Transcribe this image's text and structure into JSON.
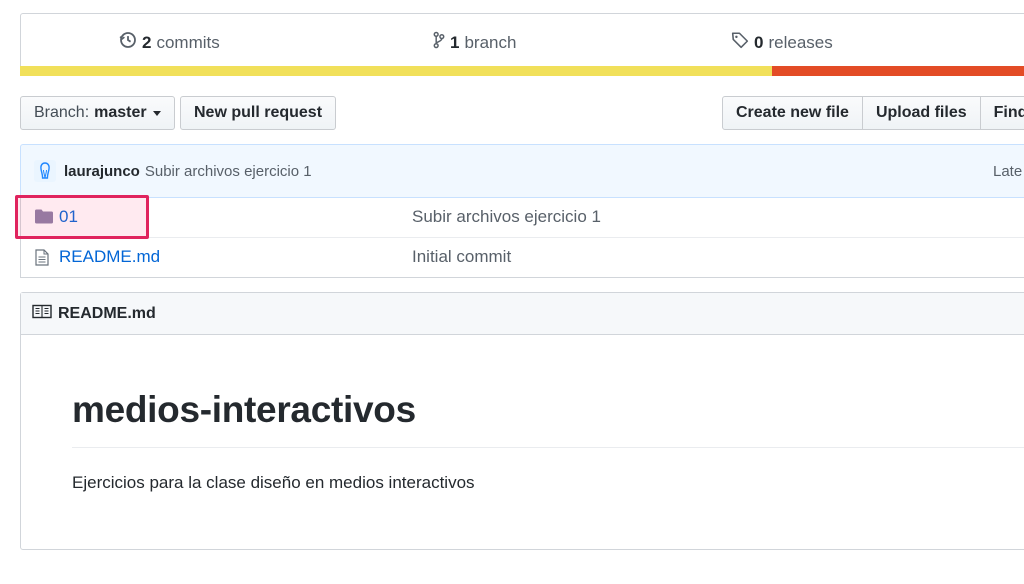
{
  "summary": {
    "commits": {
      "count": "2",
      "label": "commits"
    },
    "branches": {
      "count": "1",
      "label": "branch"
    },
    "releases": {
      "count": "0",
      "label": "releases"
    }
  },
  "language_bar": {
    "colors": [
      "#f1e05a",
      "#e34c26"
    ]
  },
  "toolbar": {
    "branch_prefix": "Branch:",
    "branch_name": "master",
    "new_pull_request": "New pull request",
    "create_new_file": "Create new file",
    "upload_files": "Upload files",
    "find_file": "Find f"
  },
  "commit": {
    "author": "laurajunco",
    "message": "Subir archivos ejercicio 1",
    "latest": "Late"
  },
  "files": [
    {
      "name": "01",
      "type": "folder",
      "message": "Subir archivos ejercicio 1"
    },
    {
      "name": "README.md",
      "type": "file",
      "message": "Initial commit"
    }
  ],
  "readme": {
    "filename": "README.md",
    "title": "medios-interactivos",
    "description": "Ejercicios para la clase diseño en medios interactivos"
  },
  "colors": {
    "link": "#0366d6",
    "highlight": "#e0245e"
  }
}
